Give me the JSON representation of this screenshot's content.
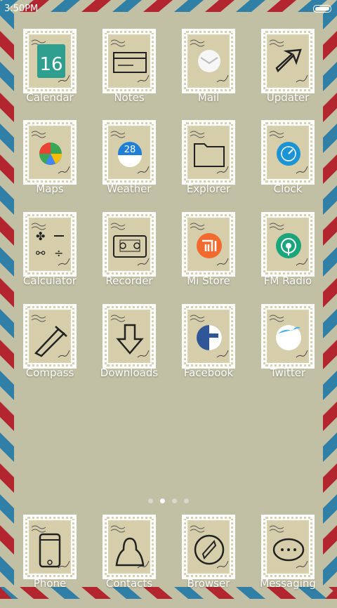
{
  "status": {
    "time": "3:50PM",
    "battery": "battery-full-icon"
  },
  "apps": [
    {
      "label": "Calendar",
      "icon": "calendar-icon",
      "calendar_day": "16"
    },
    {
      "label": "Notes",
      "icon": "notes-icon"
    },
    {
      "label": "Mail",
      "icon": "mail-icon"
    },
    {
      "label": "Updater",
      "icon": "updater-icon"
    },
    {
      "label": "Maps",
      "icon": "maps-icon"
    },
    {
      "label": "Weather",
      "icon": "weather-icon",
      "temperature": "28"
    },
    {
      "label": "Explorer",
      "icon": "folder-icon"
    },
    {
      "label": "Clock",
      "icon": "clock-icon"
    },
    {
      "label": "Calculator",
      "icon": "calculator-icon"
    },
    {
      "label": "Recorder",
      "icon": "cassette-icon"
    },
    {
      "label": "Mi Store",
      "icon": "mi-store-icon"
    },
    {
      "label": "FM Radio",
      "icon": "radio-icon"
    },
    {
      "label": "Compass",
      "icon": "compass-icon"
    },
    {
      "label": "Downloads",
      "icon": "download-icon"
    },
    {
      "label": "Facebook",
      "icon": "facebook-icon"
    },
    {
      "label": "Twitter",
      "icon": "twitter-icon"
    }
  ],
  "dock": [
    {
      "label": "Phone",
      "icon": "phone-icon"
    },
    {
      "label": "Contacts",
      "icon": "contacts-icon"
    },
    {
      "label": "Browser",
      "icon": "browser-icon"
    },
    {
      "label": "Messaging",
      "icon": "messaging-icon"
    }
  ],
  "pager": {
    "pages": 4,
    "active": 2
  },
  "colors": {
    "background": "#c1c0a4",
    "stripe_red": "#b3262f",
    "stripe_blue": "#2f7fa6",
    "stamp": "#d8d1b0"
  }
}
